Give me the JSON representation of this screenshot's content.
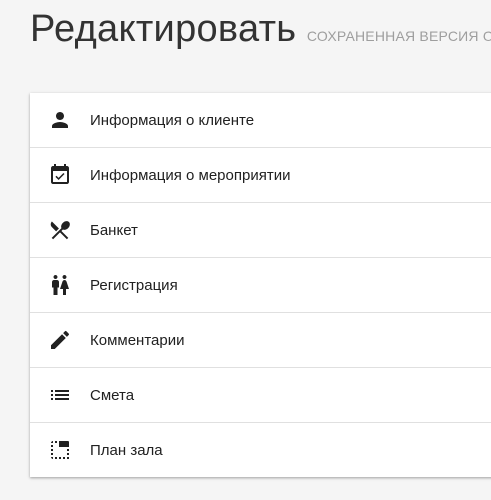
{
  "header": {
    "title": "Редактировать",
    "subtitle": "СОХРАНЕННАЯ ВЕРСИЯ ОТ"
  },
  "menu": {
    "items": [
      {
        "label": "Информация о клиенте",
        "icon": "person-icon"
      },
      {
        "label": "Информация о мероприятии",
        "icon": "event-icon"
      },
      {
        "label": "Банкет",
        "icon": "utensils-crossed-icon"
      },
      {
        "label": "Регистрация",
        "icon": "people-icon"
      },
      {
        "label": "Комментарии",
        "icon": "pencil-icon"
      },
      {
        "label": "Смета",
        "icon": "list-icon"
      },
      {
        "label": "План зала",
        "icon": "floor-plan-icon"
      }
    ]
  },
  "colors": {
    "background": "#f5f5f5",
    "card": "#ffffff",
    "text": "#212121",
    "subtitle": "#9e9e9e",
    "divider": "#e0e0e0"
  }
}
